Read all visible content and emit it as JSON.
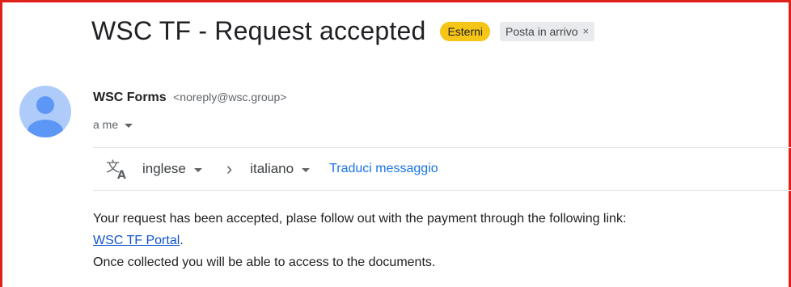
{
  "email": {
    "subject": "WSC TF - Request accepted",
    "labels": {
      "external": "Esterni",
      "inbox": "Posta in arrivo",
      "inbox_remove": "×"
    },
    "sender": {
      "name": "WSC Forms",
      "email": "<noreply@wsc.group>",
      "to": "a me"
    },
    "translate_bar": {
      "from_language": "inglese",
      "separator": "›",
      "to_language": "italiano",
      "action": "Traduci messaggio"
    },
    "body": {
      "line1": "Your request has been accepted, plase follow out with the payment through the following link:",
      "link_text": "WSC TF Portal",
      "link_suffix": ".",
      "line3": "Once collected you will be able to access to the documents."
    }
  },
  "colors": {
    "highlight_border": "#e0201b",
    "external_label": "#f5c518",
    "link": "#1a73e8",
    "avatar": "#aecbfa"
  },
  "icons": [
    "person-avatar-icon",
    "translate-icon",
    "chevron-down-icon",
    "chevron-right-icon",
    "close-icon"
  ]
}
